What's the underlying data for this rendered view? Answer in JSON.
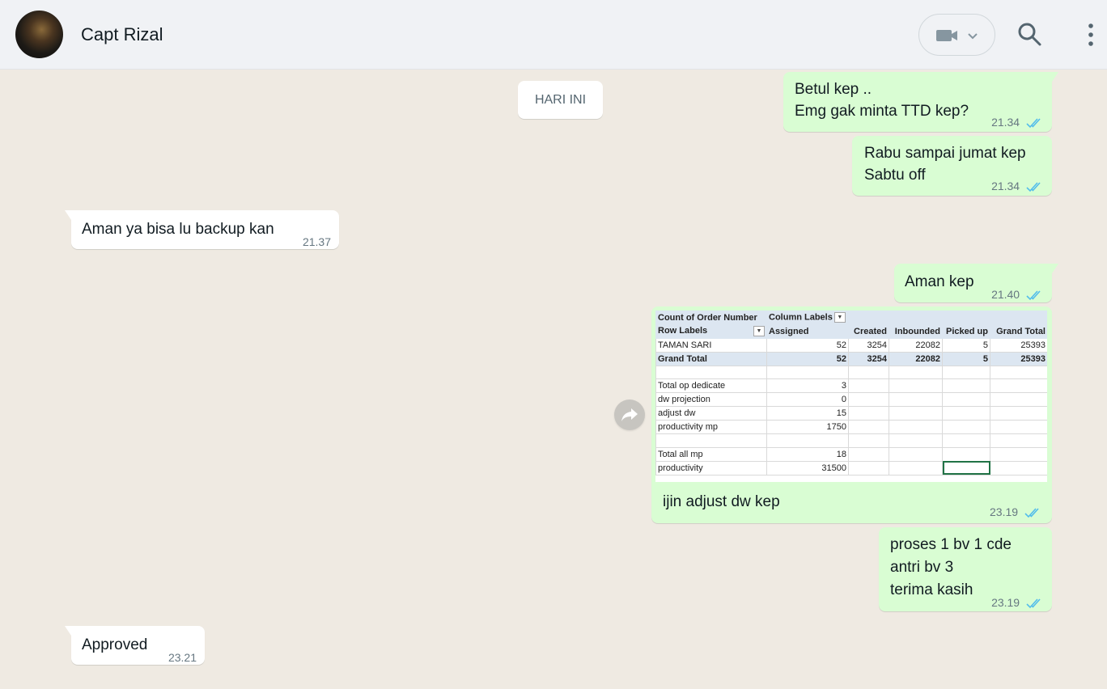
{
  "header": {
    "contact_name": "Capt Rizal",
    "icons": [
      "video-call-icon",
      "chevron-down-icon",
      "search-icon",
      "menu-icon"
    ]
  },
  "chat": {
    "day_label": "HARI INI",
    "messages": [
      {
        "direction": "out",
        "lines": [
          "Betul kep ..",
          "Emg gak minta TTD kep?"
        ],
        "time": "21.34",
        "status": "read"
      },
      {
        "direction": "out",
        "lines": [
          "Rabu sampai jumat kep",
          "Sabtu off"
        ],
        "time": "21.34",
        "status": "read"
      },
      {
        "direction": "in",
        "lines": [
          "Aman ya bisa lu backup kan"
        ],
        "time": "21.37"
      },
      {
        "direction": "out",
        "lines": [
          "Aman kep"
        ],
        "time": "21.40",
        "status": "read"
      },
      {
        "direction": "out",
        "lines": [
          "ijin adjust dw kep"
        ],
        "time": "23.19",
        "status": "read",
        "has_image": true
      },
      {
        "direction": "out",
        "lines": [
          "proses 1 bv 1 cde",
          "antri bv 3",
          "terima kasih"
        ],
        "time": "23.19",
        "status": "read"
      },
      {
        "direction": "in",
        "lines": [
          "Approved"
        ],
        "time": "23.21"
      }
    ]
  },
  "spreadsheet": {
    "header_row1": [
      "Count of Order Number",
      "Column Labels",
      "",
      "",
      "",
      ""
    ],
    "header_row2": [
      "Row Labels",
      "Assigned",
      "Created",
      "Inbounded",
      "Picked up",
      "Grand Total"
    ],
    "row_taman": [
      "TAMAN SARI",
      "52",
      "3254",
      "22082",
      "5",
      "25393"
    ],
    "row_grand": [
      "Grand Total",
      "52",
      "3254",
      "22082",
      "5",
      "25393"
    ],
    "extra_rows": [
      [
        "Total op dedicate",
        "3"
      ],
      [
        "dw projection",
        "0"
      ],
      [
        "adjust dw",
        "15"
      ],
      [
        "productivity mp",
        "1750"
      ],
      [
        "",
        ""
      ],
      [
        "Total all mp",
        "18"
      ],
      [
        "productivity",
        "31500"
      ]
    ]
  },
  "colors": {
    "header_bg": "#f0f2f5",
    "chat_bg": "#efeae2",
    "outgoing_bubble": "#d9fdd3",
    "incoming_bubble": "#ffffff",
    "read_tick": "#53bdeb",
    "pivot_header": "#dce6f1"
  }
}
